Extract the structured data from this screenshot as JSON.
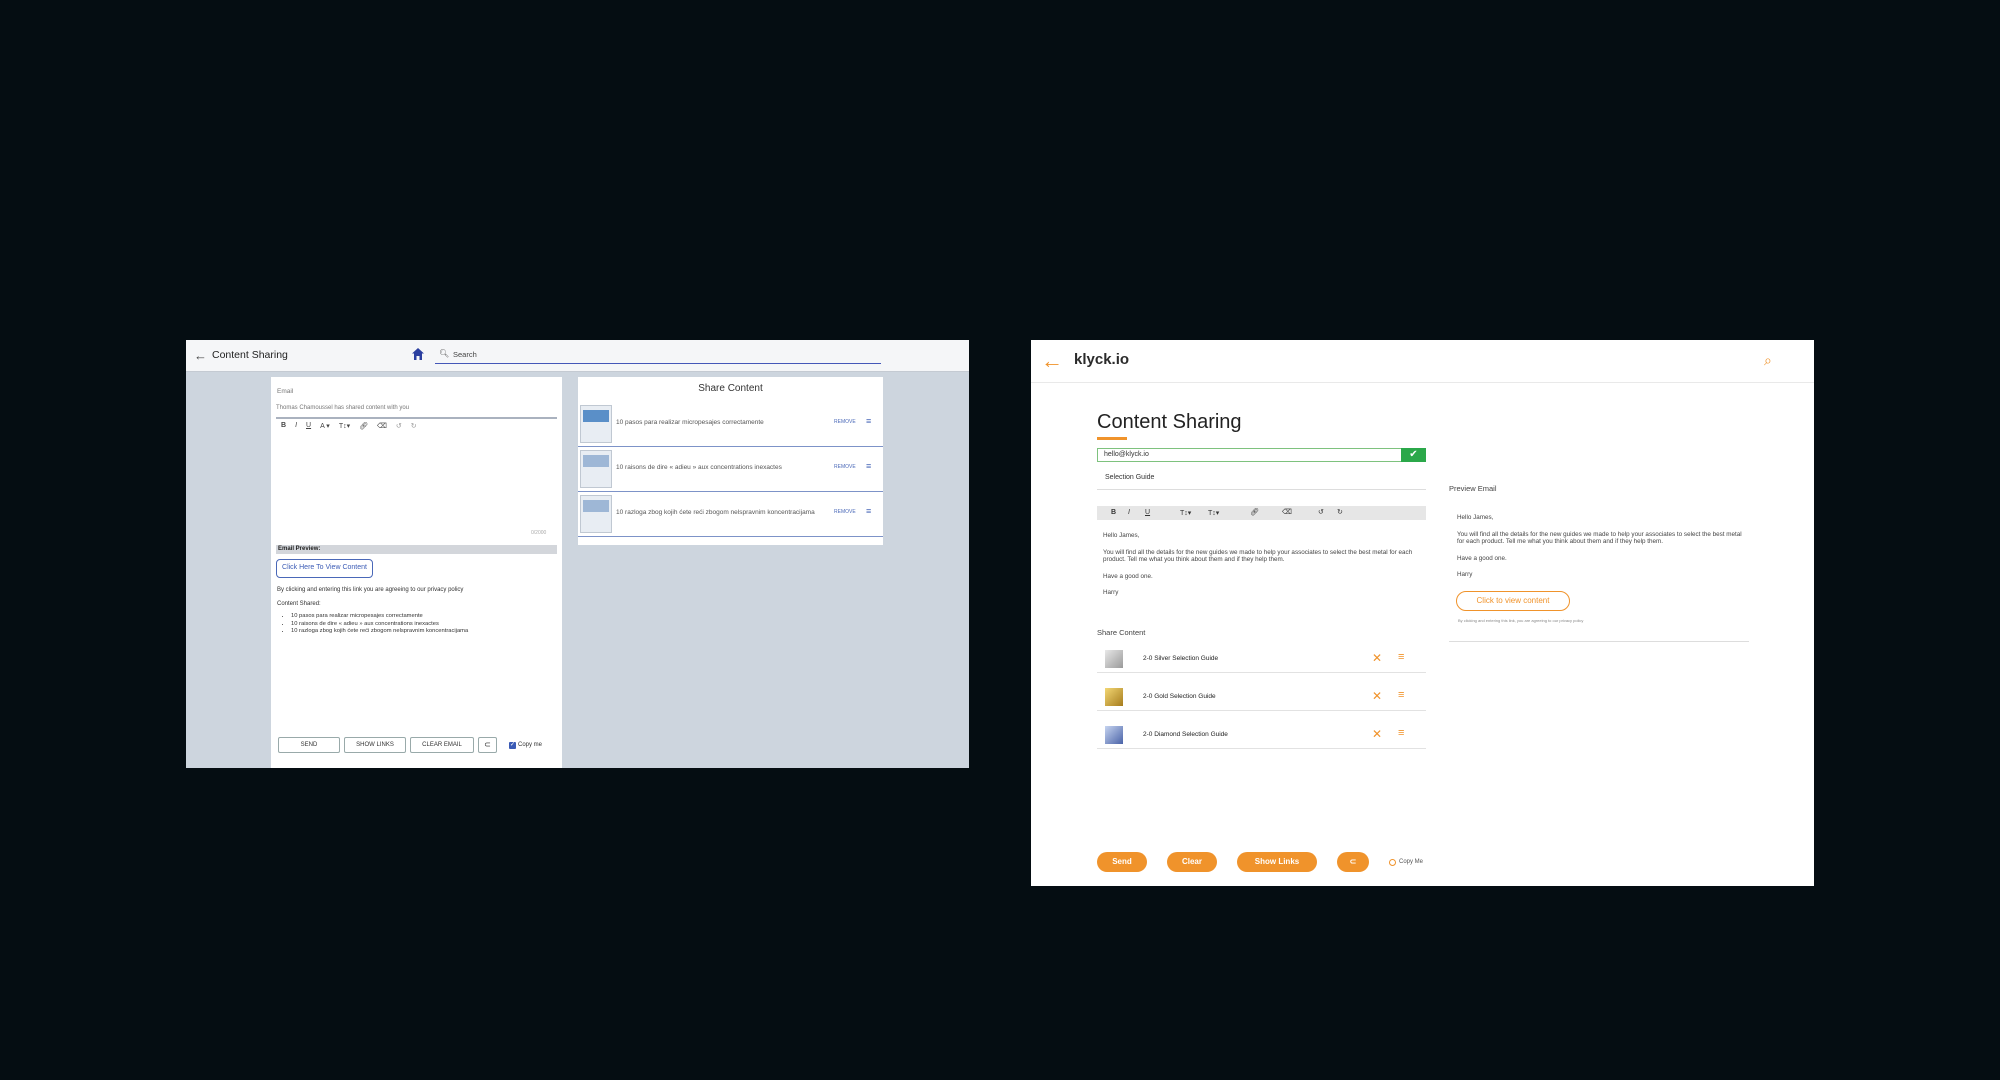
{
  "left_app": {
    "header": {
      "back_icon": "arrow-left-icon",
      "title": "Content Sharing",
      "home_icon": "home-icon",
      "search_icon": "search-icon",
      "search_placeholder": "Search"
    },
    "email_panel": {
      "email_label": "Email",
      "subject": "Thomas Chamoussel has shared content with you",
      "toolbar": [
        "B",
        "I",
        "U",
        "A ▾",
        "T↕▾",
        "link",
        "eraser",
        "undo",
        "redo"
      ],
      "char_count": "0/2000",
      "preview_label": "Email Preview:",
      "view_button": "Click Here To View Content",
      "privacy_text": "By clicking and entering this link you are agreeing to our privacy policy",
      "shared_title": "Content Shared:",
      "shared_items": [
        "10 pasos para realizar micropesajes correctamente",
        "10 raisons de dire « adieu » aux concentrations inexactes",
        "10 razloga zbog kojih ćete reći zbogom nelspravnim koncentracijama"
      ],
      "buttons": {
        "send": "SEND",
        "show_links": "SHOW LINKS",
        "clear_email": "CLEAR EMAIL",
        "attach_icon": "paperclip-icon"
      },
      "copy_me": "Copy me"
    },
    "share_panel": {
      "title": "Share Content",
      "items": [
        {
          "text": "10 pasos para realizar micropesajes correctamente",
          "remove": "REMOVE"
        },
        {
          "text": "10 raisons de dire « adieu » aux concentrations inexactes",
          "remove": "REMOVE"
        },
        {
          "text": "10 razloga zbog kojih ćete reći zbogom nelspravnim koncentracijama",
          "remove": "REMOVE"
        }
      ]
    }
  },
  "right_app": {
    "header": {
      "back_icon": "arrow-left-icon",
      "logo": "klyck.io",
      "search_icon": "search-icon"
    },
    "title": "Content Sharing",
    "email_value": "hello@klyck.io",
    "subject": "Selection Guide",
    "toolbar": [
      "B",
      "I",
      "U",
      "T↕▾",
      "T↕▾",
      "link",
      "eraser",
      "undo",
      "redo"
    ],
    "body": [
      "Hello James,",
      "You will find all the details for the new guides we made to help your associates to select the best metal for each product. Tell me what you think about them and if they help them.",
      "Have a good one.",
      "Harry"
    ],
    "share_title": "Share Content",
    "share_items": [
      {
        "text": "2-0 Silver Selection Guide",
        "thumb_color": "#b8b8b8"
      },
      {
        "text": "2-0 Gold Selection Guide",
        "thumb_color": "#c9a43a"
      },
      {
        "text": "2-0 Diamond Selection Guide",
        "thumb_color": "#7b95c9"
      }
    ],
    "preview": {
      "label": "Preview Email",
      "body": [
        "Hello James,",
        "You will find all the details for the new guides we made to help your associates to select the best metal for each product. Tell me what you think about them and if they help them.",
        "Have a good one.",
        "Harry"
      ],
      "button": "Click to view content",
      "privacy": "By clicking and entering this link, you are agreeing to our privacy policy"
    },
    "buttons": {
      "send": "Send",
      "clear": "Clear",
      "show_links": "Show Links",
      "attach_icon": "paperclip-icon"
    },
    "copy_me": "Copy Me",
    "accent_color": "#f0932b"
  }
}
